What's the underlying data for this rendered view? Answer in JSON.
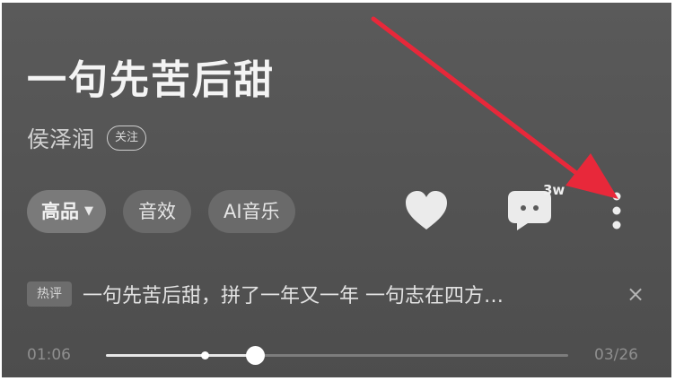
{
  "song": {
    "title": "一句先苦后甜",
    "artist": "侯泽润",
    "follow_label": "关注"
  },
  "chips": {
    "quality": "高品",
    "sound_effect": "音效",
    "ai_music": "AI音乐"
  },
  "actions": {
    "comment_count": "3w"
  },
  "hot_comment": {
    "tag": "热评",
    "text": "一句先苦后甜，拼了一年又一年 一句志在四方…",
    "close": "×"
  },
  "player": {
    "current_time": "01:06",
    "duration": "03/26",
    "progress_fraction": 0.324,
    "marker_fraction": 0.215
  },
  "colors": {
    "background": "#545454",
    "annotation_arrow": "#e8283a"
  },
  "icons": [
    "heart-icon",
    "comment-icon",
    "more-vertical-icon",
    "chevron-down-icon",
    "close-icon"
  ]
}
